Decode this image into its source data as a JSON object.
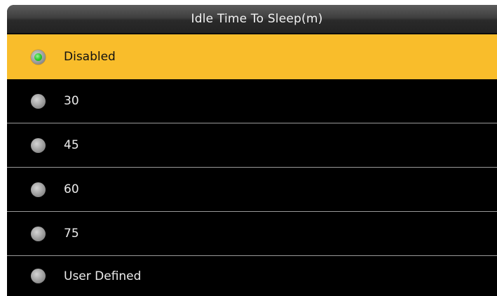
{
  "title": "Idle Time To Sleep(m)",
  "options": [
    {
      "label": "Disabled",
      "selected": true
    },
    {
      "label": "30",
      "selected": false
    },
    {
      "label": "45",
      "selected": false
    },
    {
      "label": "60",
      "selected": false
    },
    {
      "label": "75",
      "selected": false
    },
    {
      "label": "User Defined",
      "selected": false
    }
  ],
  "colors": {
    "selected_background": "#f9bd2b",
    "background": "#000000",
    "radio_selected": "#2ccc2c",
    "radio_unselected": "#a6a6a6"
  }
}
